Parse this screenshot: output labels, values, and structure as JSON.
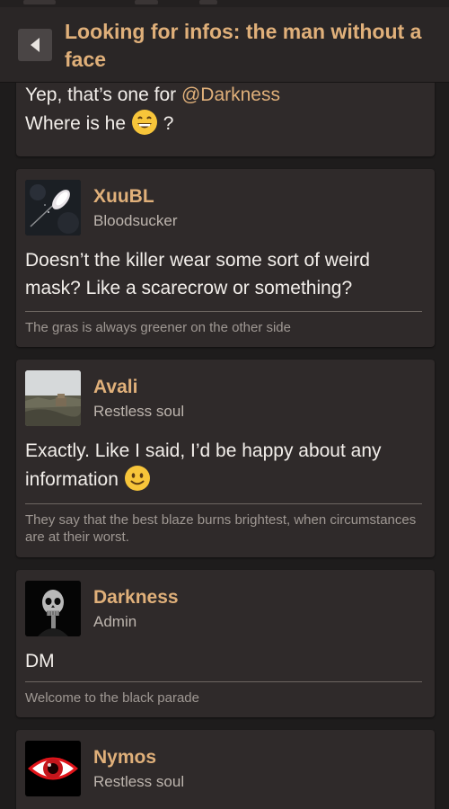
{
  "header": {
    "back_icon": "chevron-left-icon",
    "title": "Looking for infos: the man without a face"
  },
  "partial_post": {
    "line1_prefix": "Yep, that’s one for ",
    "mention": "@Darkness",
    "line2_prefix": "Where is he ",
    "line2_suffix": " ?",
    "emoji": "grinning-face-icon"
  },
  "posts": [
    {
      "username": "XuuBL",
      "rank": "Bloodsucker",
      "message": "Doesn’t the killer wear some sort of weird mask? Like a scarecrow or something?",
      "signature": "The gras is always greener on the other side",
      "avatar": "feather-avatar"
    },
    {
      "username": "Avali",
      "rank": "Restless soul",
      "message": "Exactly. Like I said, I’d be happy about any information",
      "emoji": "slightly-smiling-face-icon",
      "signature": "They say that the best blaze burns brightest, when circumstances are at their worst.",
      "avatar": "landscape-avatar"
    },
    {
      "username": "Darkness",
      "rank": "Admin",
      "message": "DM",
      "signature": "Welcome to the black parade",
      "avatar": "skull-avatar"
    },
    {
      "username": "Nymos",
      "rank": "Restless soul",
      "avatar": "red-eye-avatar"
    }
  ],
  "colors": {
    "accent": "#e0b07a",
    "card": "#2f2a2a",
    "background": "#1e1c1c",
    "header": "#2a2626"
  }
}
